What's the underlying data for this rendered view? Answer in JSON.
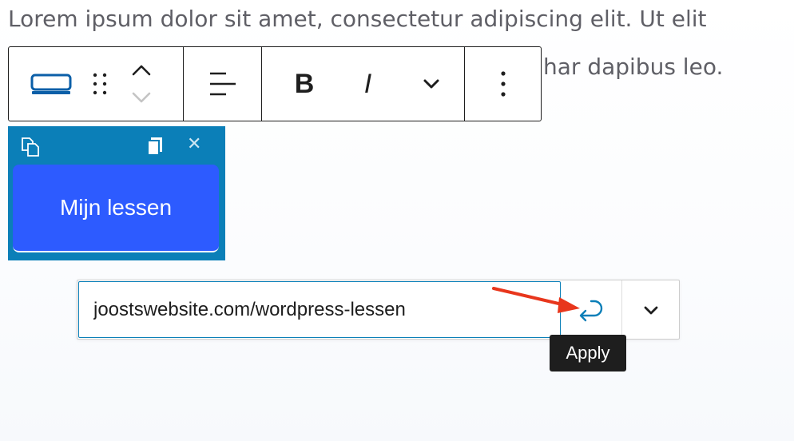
{
  "paragraph": {
    "line1": "Lorem ipsum dolor sit amet, consectetur adipiscing elit. Ut elit",
    "line2_visible": "har dapibus leo."
  },
  "toolbar": {
    "block_type_icon": "button-block-icon",
    "drag_icon": "drag-handle-icon",
    "move_up_icon": "chevron-up-icon",
    "move_down_icon": "chevron-down-icon",
    "align_icon": "justify-left-icon",
    "bold_label": "B",
    "italic_label": "I",
    "more_formatting_icon": "chevron-down-icon",
    "options_icon": "more-vertical-icon"
  },
  "button_block": {
    "label": "Mijn lessen",
    "background_color": "#0b7fb8",
    "button_color": "#2d5bff"
  },
  "url_popover": {
    "value": "joostswebsite.com/wordpress-lessen",
    "apply_icon": "enter-return-icon",
    "settings_icon": "chevron-down-icon",
    "tooltip": "Apply"
  },
  "colors": {
    "accent": "#0b7fb8",
    "annotation_arrow": "#e8361c",
    "text": "#1e1e1e"
  }
}
